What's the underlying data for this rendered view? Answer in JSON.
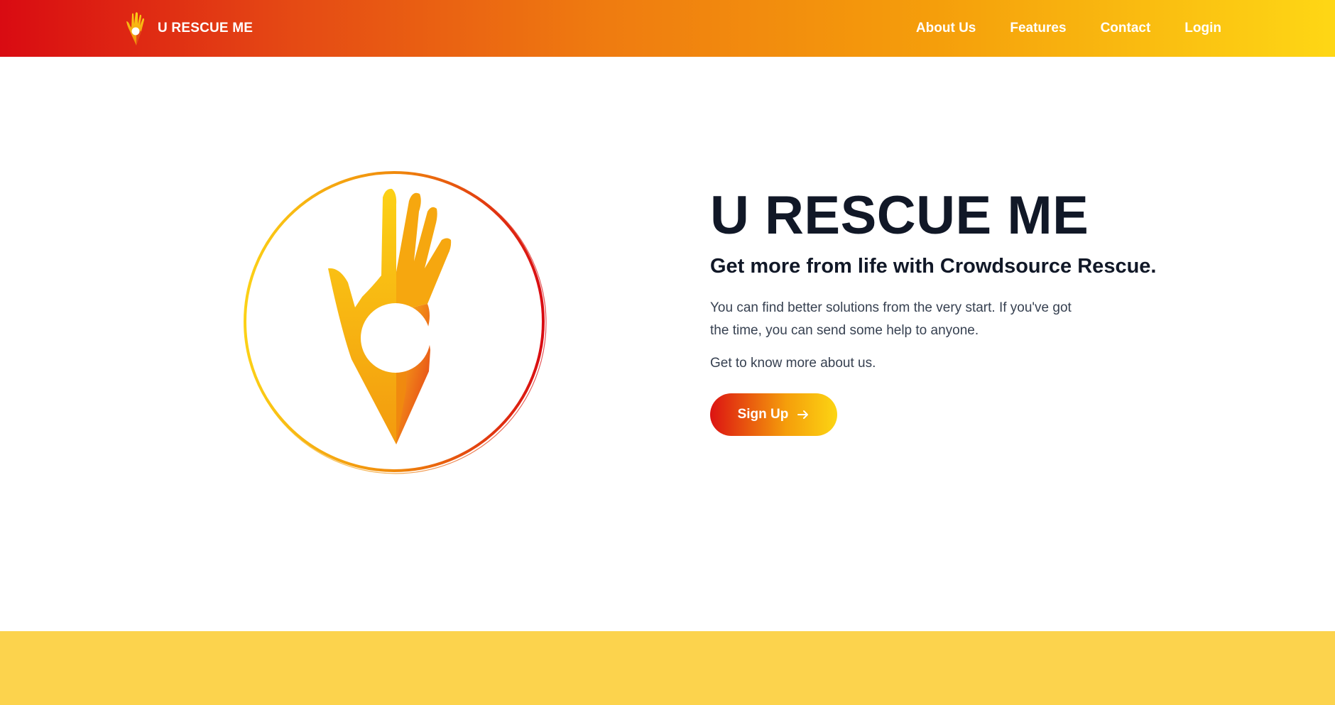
{
  "brand": {
    "name": "U RESCUE ME",
    "icon": "hand-logo-icon"
  },
  "nav": {
    "items": [
      {
        "label": "About Us"
      },
      {
        "label": "Features"
      },
      {
        "label": "Contact"
      },
      {
        "label": "Login"
      }
    ]
  },
  "hero": {
    "title": "U RESCUE ME",
    "subtitle": "Get more from life with Crowdsource Rescue.",
    "body": "You can find better solutions from the very start. If you've got the time, you can send some help to anyone.",
    "more": "Get to know more about us.",
    "cta_label": "Sign Up",
    "cta_icon": "arrow-right-icon",
    "logo_icon": "hand-in-circle-logo-icon"
  },
  "colors": {
    "gradient_start": "#d90b12",
    "gradient_mid": "#f59e0b",
    "gradient_end": "#fed715",
    "heading": "#111827",
    "body_text": "#374151",
    "footer_band": "#fcd34d"
  }
}
